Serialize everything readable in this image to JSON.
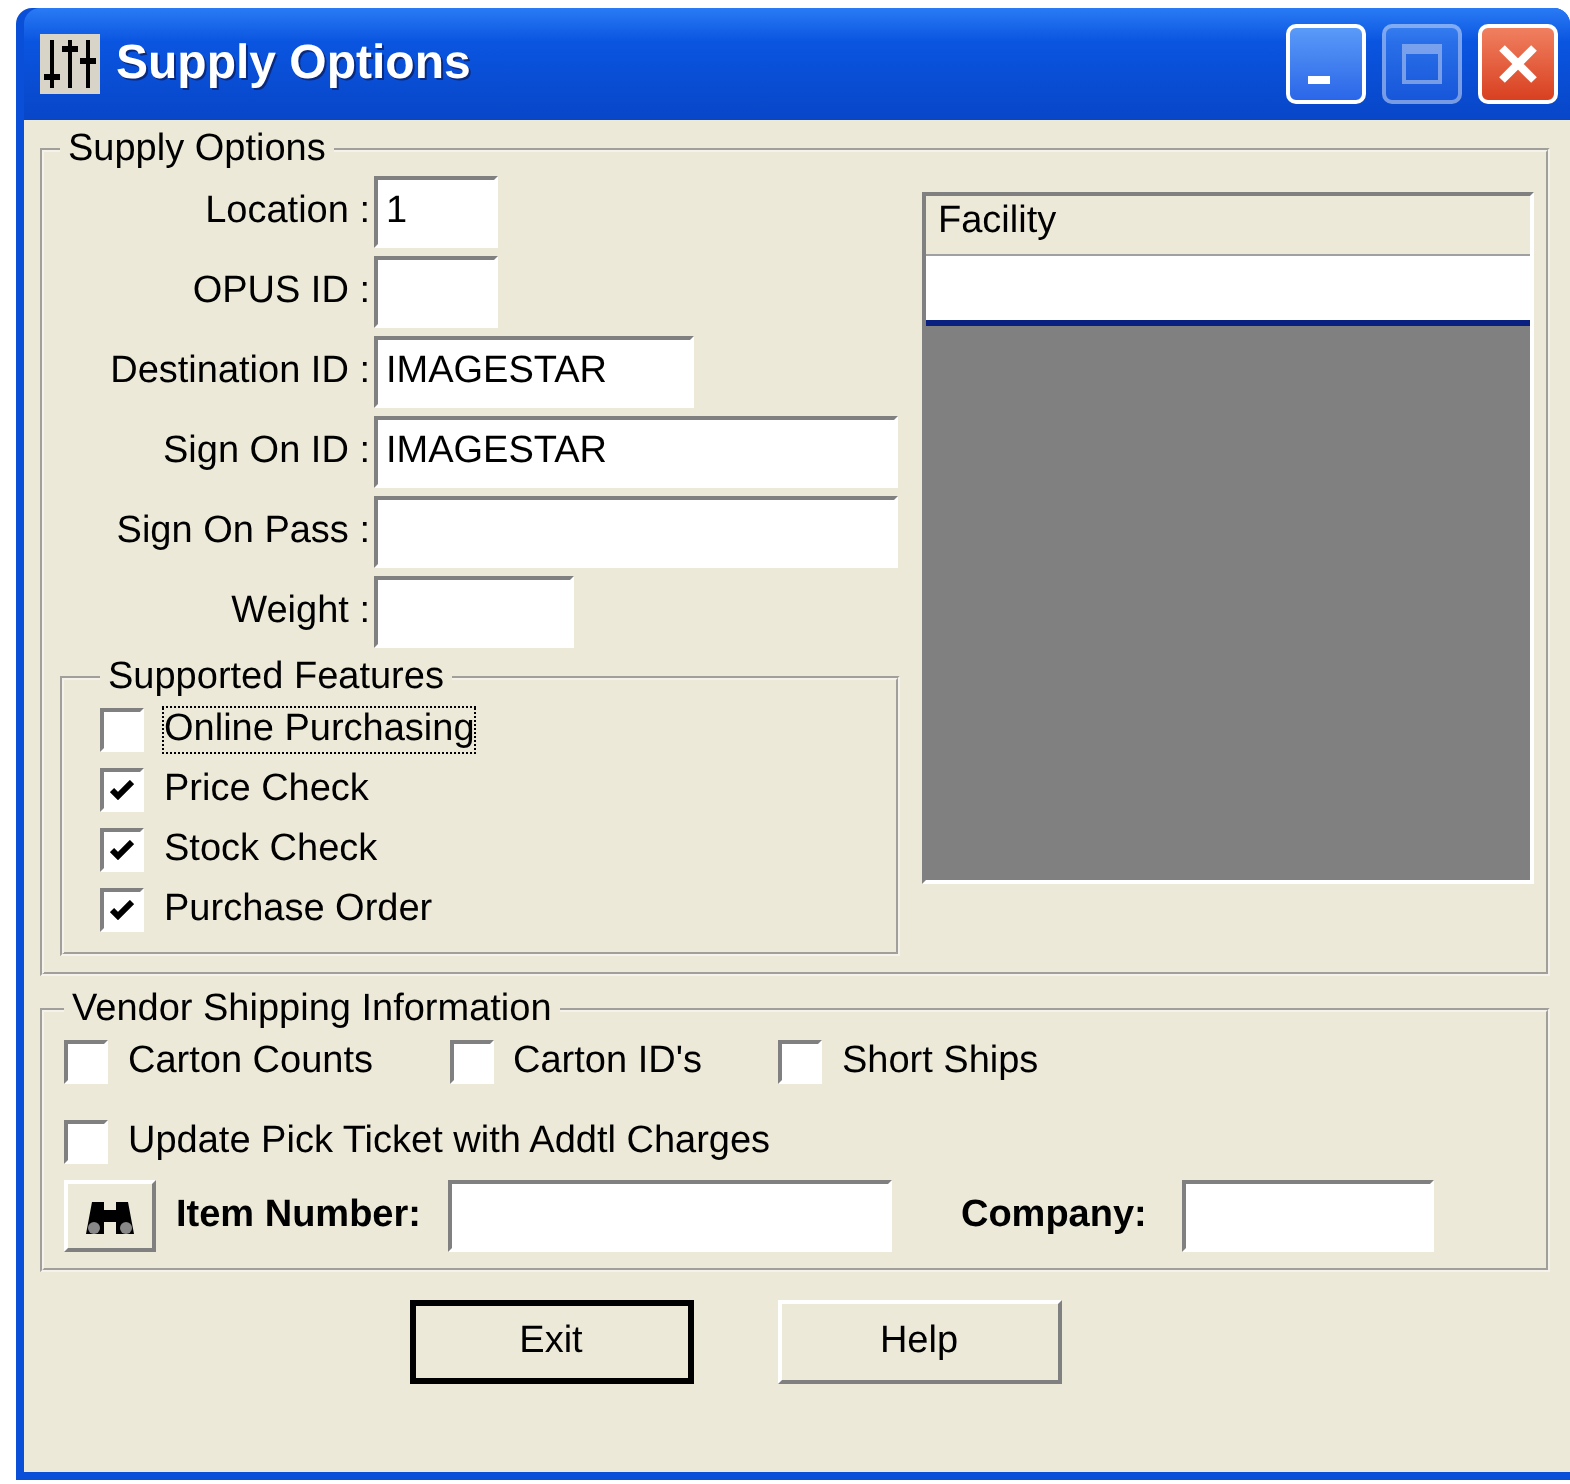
{
  "window": {
    "title": "Supply Options",
    "buttons": [
      {
        "kind": "minimize",
        "disabled": false
      },
      {
        "kind": "maximize",
        "disabled": true
      },
      {
        "kind": "close",
        "disabled": false
      }
    ]
  },
  "supply_options": {
    "legend": "Supply Options",
    "fields": [
      {
        "label": "Location :",
        "value": "1"
      },
      {
        "label": "OPUS ID :"
      },
      {
        "label": "Destination ID :",
        "value": "IMAGESTAR"
      },
      {
        "label": "Sign On ID :",
        "value": "IMAGESTAR"
      },
      {
        "label": "Sign On Pass :"
      },
      {
        "label": "Weight :"
      }
    ],
    "features": {
      "legend": "Supported Features",
      "items": [
        {
          "label": "Online Purchasing",
          "checked": false,
          "focused": true
        },
        {
          "label": "Price Check",
          "checked": true,
          "focused": false
        },
        {
          "label": "Stock Check",
          "checked": true,
          "focused": false
        },
        {
          "label": "Purchase Order",
          "checked": true,
          "focused": false
        }
      ]
    },
    "facility_list": {
      "column": "Facility"
    }
  },
  "vendor_shipping": {
    "legend": "Vendor Shipping Information",
    "options": [
      {
        "label": "Carton Counts",
        "checked": false
      },
      {
        "label": "Carton ID's",
        "checked": false
      },
      {
        "label": "Short Ships",
        "checked": false
      }
    ],
    "update_option": {
      "label": "Update Pick Ticket with Addtl Charges",
      "checked": false
    },
    "item_number": {
      "label": "Item Number:"
    },
    "company": {
      "label": "Company:"
    }
  },
  "buttons": [
    {
      "label": "Exit",
      "default": true
    },
    {
      "label": "Help",
      "default": false
    }
  ]
}
